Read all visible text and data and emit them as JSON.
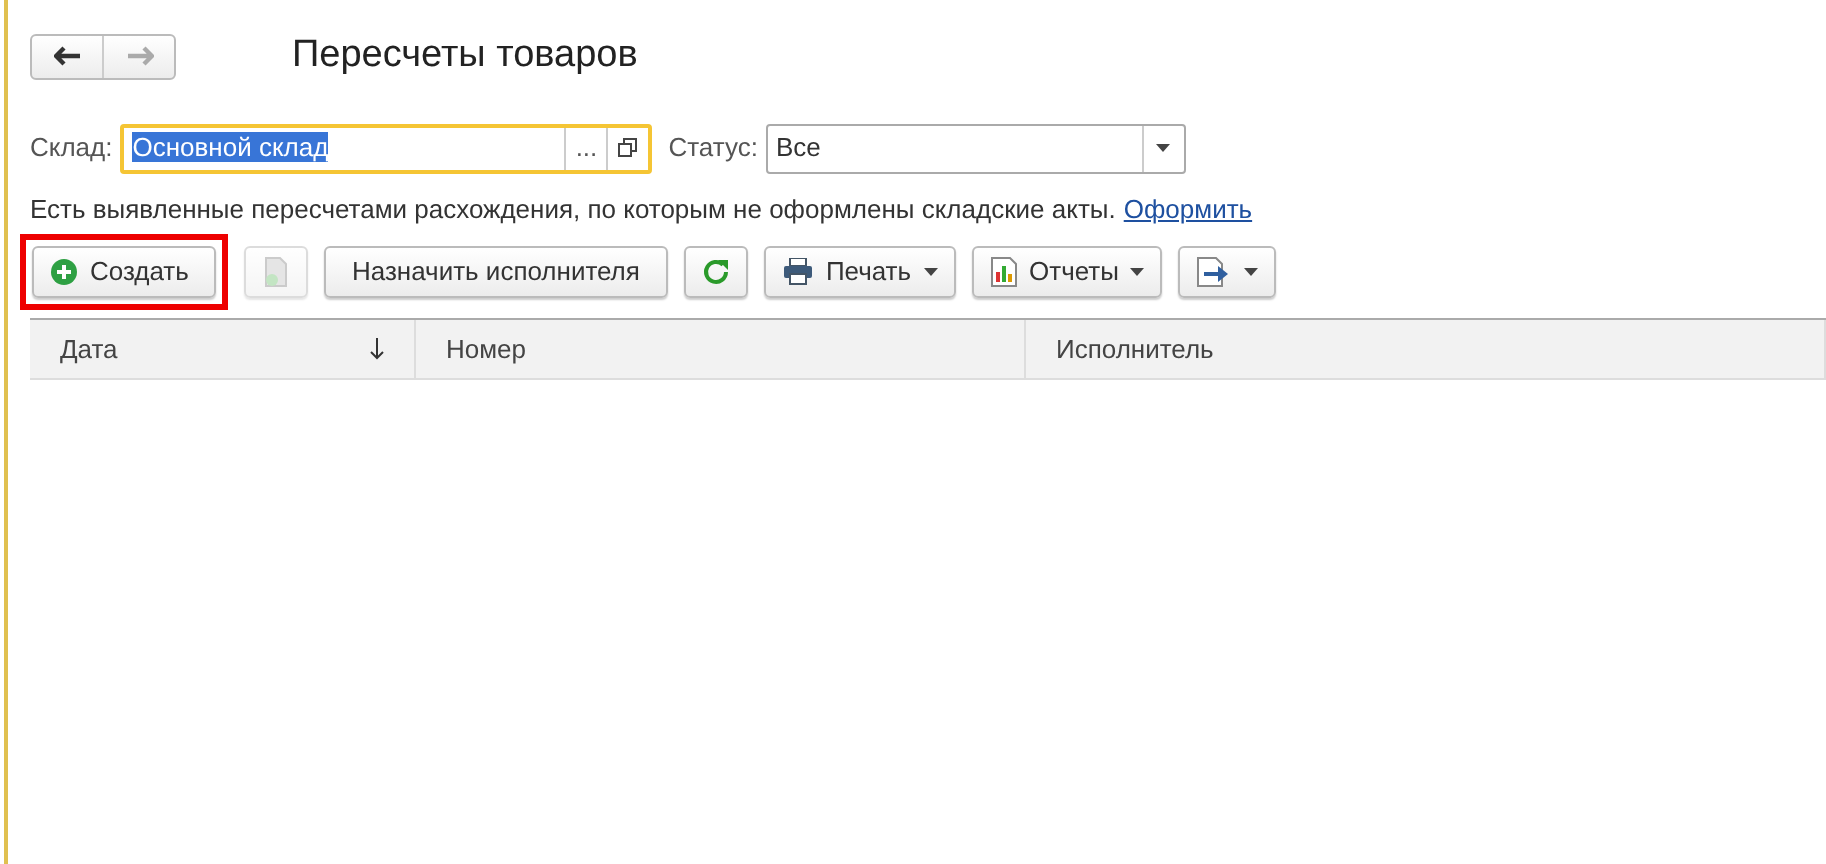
{
  "window": {
    "title": "Пересчеты товаров"
  },
  "navigation": [
    {
      "kind": "back",
      "disabled": false
    },
    {
      "kind": "forward",
      "disabled": true
    }
  ],
  "warehouse": {
    "label": "Склад:",
    "value": "Основной склад",
    "selected": true,
    "choose_button": "..."
  },
  "status": {
    "label": "Статус:",
    "value": "Все"
  },
  "notice": {
    "text": "Есть выявленные пересчетами расхождения, по которым не оформлены складские акты.",
    "link": "Оформить"
  },
  "toolbar": [
    {
      "kind": "create",
      "label": "Создать",
      "disabled": false,
      "highlighted": true
    },
    {
      "kind": "copy",
      "disabled": true,
      "highlighted": false
    },
    {
      "kind": "text",
      "label": "Назначить исполнителя",
      "disabled": false,
      "highlighted": false
    },
    {
      "kind": "refresh",
      "disabled": false,
      "highlighted": false
    },
    {
      "kind": "print",
      "label": "Печать",
      "disabled": false,
      "highlighted": false
    },
    {
      "kind": "reports",
      "label": "Отчеты",
      "disabled": false,
      "highlighted": false
    },
    {
      "kind": "export",
      "disabled": false,
      "highlighted": false
    }
  ],
  "table": {
    "columns": [
      {
        "label": "Дата",
        "sorted": true
      },
      {
        "label": "Номер",
        "sorted": false
      },
      {
        "label": "Исполнитель",
        "sorted": false
      }
    ]
  }
}
